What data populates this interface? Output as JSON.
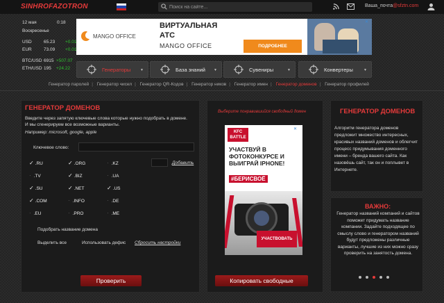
{
  "header": {
    "logo": "SINHROFAZOTRON",
    "search_placeholder": "Поиск на сайте...",
    "email_user": "Ваша_почта",
    "email_domain": "@sfztn.com"
  },
  "info": {
    "date": "12 мая",
    "time": "0:18",
    "weekday": "Воскресенье",
    "rates": [
      {
        "name": "USD",
        "value": "65.23",
        "change": "+0.01"
      },
      {
        "name": "EUR",
        "value": "73.09",
        "change": "+0.01"
      },
      {
        "name": "BTC/USD",
        "value": "6915",
        "change": "+507.07"
      },
      {
        "name": "ETH/USD",
        "value": "195",
        "change": "+24.22"
      }
    ]
  },
  "ad_top": {
    "brand": "MANGO OFFICE",
    "headline_1": "ВИРТУАЛЬНАЯ",
    "headline_2": "АТС",
    "subline": "MANGO OFFICE",
    "cta": "ПОДРОБНЕЕ"
  },
  "nav": {
    "items": [
      "Генераторы",
      "База знаний",
      "Сувениры",
      "Конвертеры"
    ]
  },
  "breadcrumbs": [
    "Генератор паролей",
    "Генератор чисел",
    "Генератор QR-Кодов",
    "Генератор ников",
    "Генератор имен",
    "Генератор доменов",
    "Генератор профилей"
  ],
  "main": {
    "title": "ГЕНЕРАТОР ДОМЕНОВ",
    "intro": "Введите через запятую ключевые слова которые нужно подобрать в домене. И мы сгенерируем все возможные варианты.",
    "example": "Например: microsoft, google, apple",
    "keyword_label": "Ключевое слово:",
    "keyword_value": "",
    "add_link": "Добавить",
    "domains": [
      {
        "label": ".RU",
        "checked": true
      },
      {
        "label": ".ORG",
        "checked": true
      },
      {
        "label": ".KZ",
        "checked": false
      },
      {
        "label": ".TV",
        "checked": false
      },
      {
        "label": ".BIZ",
        "checked": true
      },
      {
        "label": ".UA",
        "checked": false
      },
      {
        "label": ".SU",
        "checked": true
      },
      {
        "label": ".NET",
        "checked": true
      },
      {
        "label": ".US",
        "checked": true
      },
      {
        "label": ".COM",
        "checked": true
      },
      {
        "label": ".INFO",
        "checked": false
      },
      {
        "label": ".DE",
        "checked": false
      },
      {
        "label": ".EU",
        "checked": false
      },
      {
        "label": ".PRO",
        "checked": false
      },
      {
        "label": ".ME",
        "checked": false
      }
    ],
    "option_match": "Подобрать название домена",
    "option_select_all": "Выделить все",
    "option_hyphen": "Использовать дефис",
    "reset_link": "Сбросить настройки",
    "check_button": "Проверить"
  },
  "middle": {
    "hint": "Выберите понравившийся свободный домен",
    "copy_button": "Копировать свободные"
  },
  "ad_side": {
    "badge_1": "KFC",
    "badge_2": "BATTLE",
    "text": "УЧАСТВУЙ В ФОТОКОНКУРСЕ И ВЫИГРАЙ IPHONE!",
    "hashtag": "#БЕРИСВОЁ",
    "cta": "УЧАСТВОВАТЬ"
  },
  "right": {
    "title": "ГЕНЕРАТОР ДОМЕНОВ",
    "description": "Алгоритм генератора доменов предложит множество интересных, красивых названий доменов и облегчит процесс придумывания доменного имени – бренда вашего сайта. Как назовёшь сайт, так он и поплывет в Интернете.",
    "important_title": "ВАЖНО:",
    "important_text": "Генератор названий компаний и сайтов поможет придумать название компании. Задайте подходящее по смыслу слово и генератором названий будут предложены различные варианты, лучшие из них можно сразу проверить на занятость домена."
  },
  "colors": {
    "accent": "#e53a3a",
    "bg": "#2b2b2b",
    "panel": "#1b1b1b",
    "positive": "#2fc12f"
  }
}
